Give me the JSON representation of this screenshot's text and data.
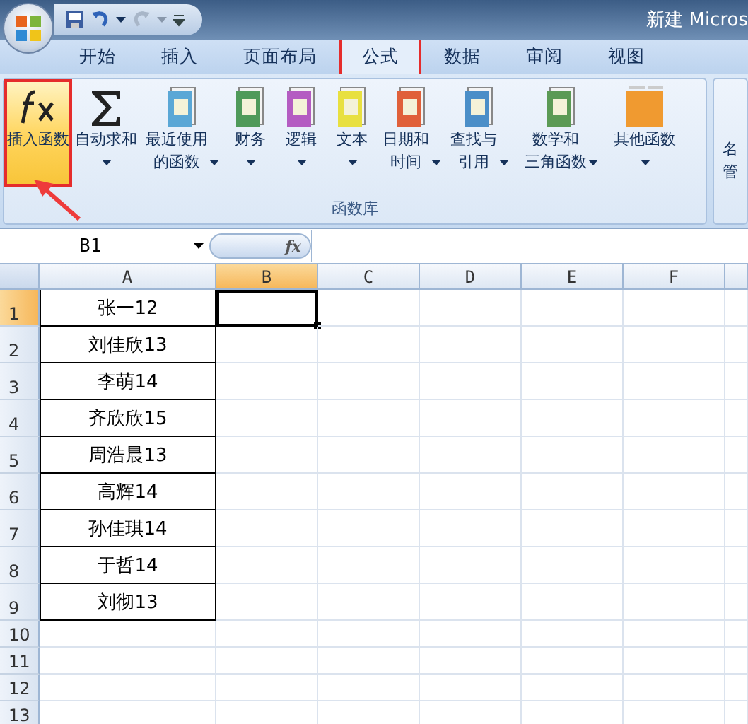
{
  "window": {
    "title": "新建 Micros"
  },
  "tabs": [
    {
      "label": "开始",
      "selected": false
    },
    {
      "label": "插入",
      "selected": false
    },
    {
      "label": "页面布局",
      "selected": false
    },
    {
      "label": "公式",
      "selected": true
    },
    {
      "label": "数据",
      "selected": false
    },
    {
      "label": "审阅",
      "selected": false
    },
    {
      "label": "视图",
      "selected": false
    }
  ],
  "ribbon": {
    "group_label": "函数库",
    "buttons": [
      {
        "kind": "fx",
        "lines": [
          "插入函数"
        ],
        "has_menu": false,
        "highlighted": true
      },
      {
        "kind": "sigma",
        "lines": [
          "自动求和"
        ],
        "has_menu": true,
        "highlighted": false
      },
      {
        "kind": "book",
        "color": "#5aa7d6",
        "lines": [
          "最近使用",
          "的函数"
        ],
        "has_menu": true,
        "highlighted": false
      },
      {
        "kind": "book",
        "color": "#4f9a5a",
        "lines": [
          "财务"
        ],
        "has_menu": true,
        "highlighted": false
      },
      {
        "kind": "book",
        "color": "#b45cc2",
        "lines": [
          "逻辑"
        ],
        "has_menu": true,
        "highlighted": false
      },
      {
        "kind": "book",
        "color": "#e8e040",
        "lines": [
          "文本"
        ],
        "has_menu": true,
        "highlighted": false
      },
      {
        "kind": "book",
        "color": "#e0603a",
        "lines": [
          "日期和",
          "时间"
        ],
        "has_menu": true,
        "highlighted": false
      },
      {
        "kind": "book",
        "color": "#4a8ec8",
        "lines": [
          "查找与",
          "引用"
        ],
        "has_menu": true,
        "highlighted": false
      },
      {
        "kind": "book",
        "color": "#5b9a55",
        "lines": [
          "数学和",
          "三角函数"
        ],
        "has_menu": true,
        "highlighted": false
      },
      {
        "kind": "books",
        "color": "#f09a30",
        "lines": [
          "其他函数"
        ],
        "has_menu": true,
        "highlighted": false
      }
    ],
    "next_group_lines": [
      "名",
      "管"
    ]
  },
  "formula_bar": {
    "name_box": "B1",
    "fx": "fx"
  },
  "sheet": {
    "columns": [
      {
        "label": "A",
        "selected": false
      },
      {
        "label": "B",
        "selected": true
      },
      {
        "label": "C",
        "selected": false
      },
      {
        "label": "D",
        "selected": false
      },
      {
        "label": "E",
        "selected": false
      },
      {
        "label": "F",
        "selected": false
      }
    ],
    "rows": [
      {
        "number": "1",
        "selected": true,
        "a": "张一12"
      },
      {
        "number": "2",
        "selected": false,
        "a": "刘佳欣13"
      },
      {
        "number": "3",
        "selected": false,
        "a": "李萌14"
      },
      {
        "number": "4",
        "selected": false,
        "a": "齐欣欣15"
      },
      {
        "number": "5",
        "selected": false,
        "a": "周浩晨13"
      },
      {
        "number": "6",
        "selected": false,
        "a": "高辉14"
      },
      {
        "number": "7",
        "selected": false,
        "a": "孙佳琪14"
      },
      {
        "number": "8",
        "selected": false,
        "a": "于哲14"
      },
      {
        "number": "9",
        "selected": false,
        "a": "刘彻13"
      },
      {
        "number": "10",
        "selected": false
      },
      {
        "number": "11",
        "selected": false
      },
      {
        "number": "12",
        "selected": false
      },
      {
        "number": "13",
        "selected": false
      }
    ]
  }
}
